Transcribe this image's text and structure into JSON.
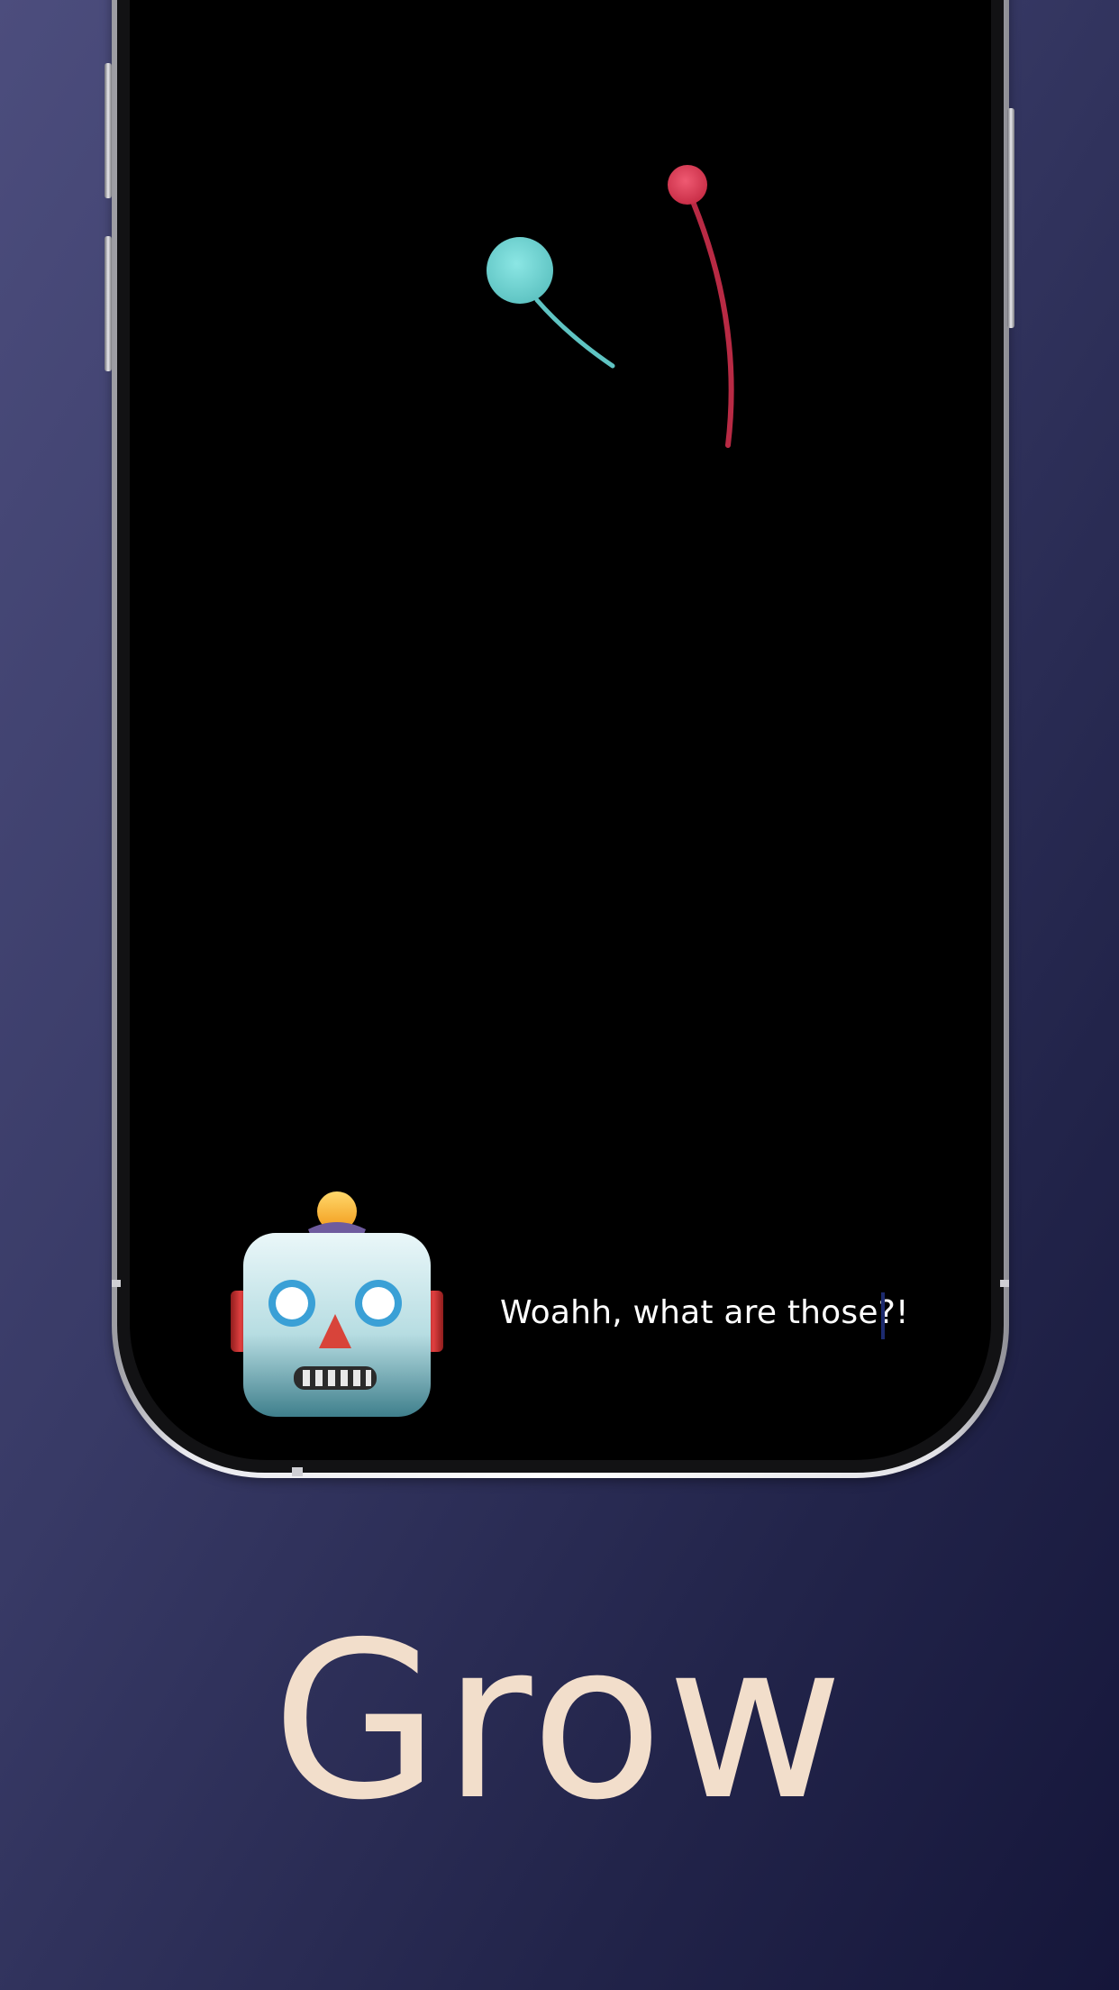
{
  "scene": {
    "dialog_text": "Woahh, what are those?!",
    "robot_icon": "robot-face-icon",
    "particle_colors": {
      "teal": "#6fd2d1",
      "red": "#d8344f"
    },
    "text_cursor_color": "#1c2a6e"
  },
  "caption": {
    "title": "Grow",
    "color": "#f2decb"
  },
  "background": {
    "gradient_start": "#4c4d7d",
    "gradient_end": "#15163a"
  }
}
